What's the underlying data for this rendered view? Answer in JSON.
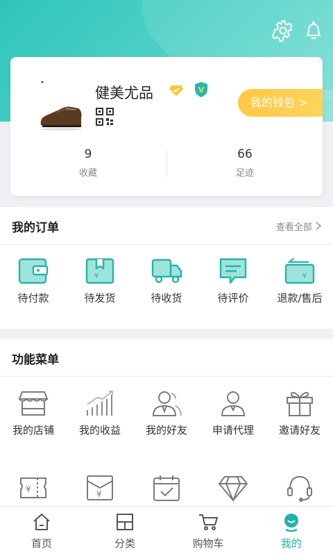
{
  "profile": {
    "nickname": "健美尤品",
    "wallet_label": "我的钱包 >",
    "stats": [
      {
        "value": "9",
        "label": "收藏"
      },
      {
        "value": "66",
        "label": "足迹"
      }
    ]
  },
  "orders": {
    "title": "我的订单",
    "view_all": "查看全部",
    "items": [
      {
        "label": "待付款",
        "icon": "wallet-icon"
      },
      {
        "label": "待发货",
        "icon": "package-icon"
      },
      {
        "label": "待收货",
        "icon": "truck-icon"
      },
      {
        "label": "待评价",
        "icon": "comment-icon"
      },
      {
        "label": "退款/售后",
        "icon": "refund-card-icon"
      }
    ]
  },
  "functions": {
    "title": "功能菜单",
    "items": [
      {
        "label": "我的店铺",
        "icon": "shop-icon"
      },
      {
        "label": "我的收益",
        "icon": "bar-chart-icon"
      },
      {
        "label": "我的好友",
        "icon": "friends-icon"
      },
      {
        "label": "申请代理",
        "icon": "person-icon"
      },
      {
        "label": "邀请好友",
        "icon": "gift-icon"
      }
    ],
    "items_row2": [
      {
        "icon": "coupon-icon"
      },
      {
        "icon": "envelope-yen-icon"
      },
      {
        "icon": "calendar-check-icon"
      },
      {
        "icon": "diamond-icon"
      },
      {
        "icon": "headset-icon"
      }
    ]
  },
  "tabbar": [
    {
      "label": "首页",
      "icon": "home-icon"
    },
    {
      "label": "分类",
      "icon": "category-icon"
    },
    {
      "label": "购物车",
      "icon": "cart-icon"
    },
    {
      "label": "我的",
      "icon": "profile-icon",
      "active": true
    }
  ],
  "colors": {
    "accent": "#1fb3a8",
    "wallet": "#ffc844",
    "active_tab": "#1fb3a8"
  }
}
